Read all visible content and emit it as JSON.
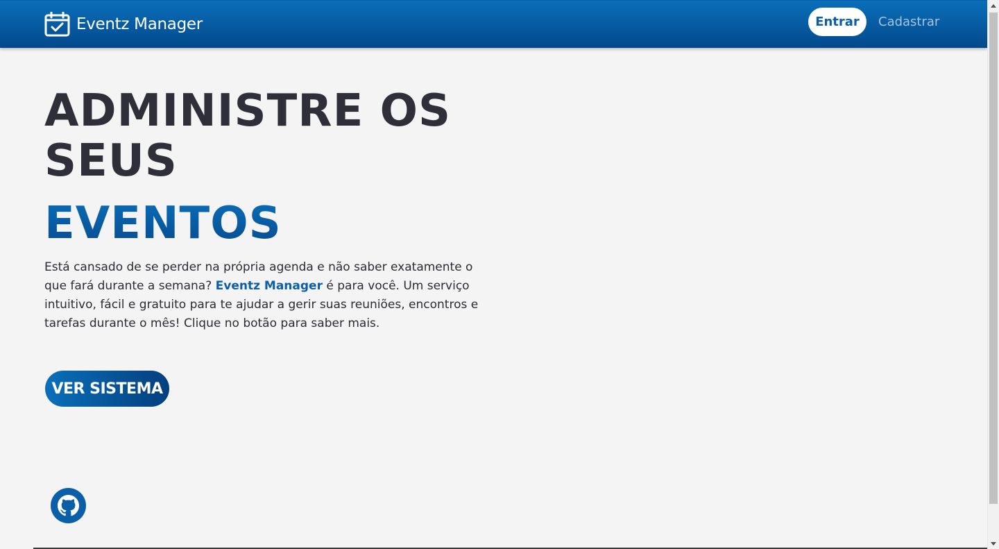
{
  "navbar": {
    "brand_name": "Eventz Manager",
    "brand_icon": "calendar-check-icon",
    "login_label": "Entrar",
    "register_label": "Cadastrar"
  },
  "hero": {
    "title": "ADMINISTRE OS SEUS",
    "accent": "EVENTOS",
    "desc_part1": "Está cansado de se perder na própria agenda e não saber exatamente o que fará durante a semana? ",
    "desc_highlight": "Eventz Manager",
    "desc_part2": " é para você. Um serviço intuitivo, fácil e gratuito para te ajudar a gerir suas reuniões, encontros e tarefas durante o mês! Clique no botão para saber mais.",
    "cta_label": "VER SISTEMA"
  },
  "footer": {
    "github_icon": "github-icon"
  },
  "colors": {
    "primary": "#0b5ea8",
    "primary_dark": "#03498c",
    "title_text": "#2f2f3a",
    "background": "#f4f4f5"
  }
}
